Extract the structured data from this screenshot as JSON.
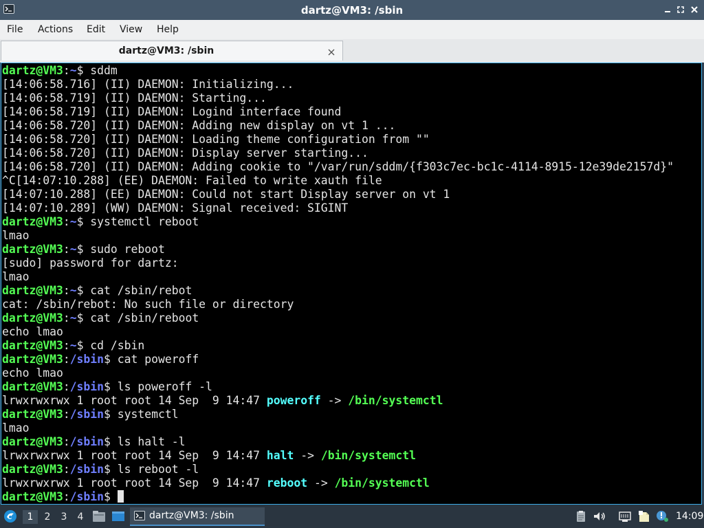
{
  "window": {
    "title": "dartz@VM3: /sbin"
  },
  "menu": {
    "items": [
      {
        "label": "File"
      },
      {
        "label": "Actions"
      },
      {
        "label": "Edit"
      },
      {
        "label": "View"
      },
      {
        "label": "Help"
      }
    ]
  },
  "tab": {
    "label": "dartz@VM3: /sbin"
  },
  "terminal": {
    "colors": {
      "background": "#000000",
      "text": "#e5e5e5",
      "prompt_user": "#54ff54",
      "prompt_path": "#6f7fff",
      "symlink": "#54ffff",
      "link_target": "#54ff54"
    },
    "lines": [
      [
        {
          "t": "dartz@VM3",
          "c": "prompt-user"
        },
        {
          "t": ":",
          "c": "plain"
        },
        {
          "t": "~",
          "c": "prompt-path"
        },
        {
          "t": "$ sddm",
          "c": "plain"
        }
      ],
      [
        {
          "t": "[14:06:58.716] (II) DAEMON: Initializing...",
          "c": "plain"
        }
      ],
      [
        {
          "t": "[14:06:58.719] (II) DAEMON: Starting...",
          "c": "plain"
        }
      ],
      [
        {
          "t": "[14:06:58.719] (II) DAEMON: Logind interface found",
          "c": "plain"
        }
      ],
      [
        {
          "t": "[14:06:58.720] (II) DAEMON: Adding new display on vt 1 ...",
          "c": "plain"
        }
      ],
      [
        {
          "t": "[14:06:58.720] (II) DAEMON: Loading theme configuration from \"\"",
          "c": "plain"
        }
      ],
      [
        {
          "t": "[14:06:58.720] (II) DAEMON: Display server starting...",
          "c": "plain"
        }
      ],
      [
        {
          "t": "[14:06:58.720] (II) DAEMON: Adding cookie to \"/var/run/sddm/{f303c7ec-bc1c-4114-8915-12e39de2157d}\"",
          "c": "plain"
        }
      ],
      [
        {
          "t": "^C[14:07:10.288] (EE) DAEMON: Failed to write xauth file",
          "c": "plain"
        }
      ],
      [
        {
          "t": "[14:07:10.288] (EE) DAEMON: Could not start Display server on vt 1",
          "c": "plain"
        }
      ],
      [
        {
          "t": "[14:07:10.289] (WW) DAEMON: Signal received: SIGINT",
          "c": "plain"
        }
      ],
      [
        {
          "t": "dartz@VM3",
          "c": "prompt-user"
        },
        {
          "t": ":",
          "c": "plain"
        },
        {
          "t": "~",
          "c": "prompt-path"
        },
        {
          "t": "$ systemctl reboot",
          "c": "plain"
        }
      ],
      [
        {
          "t": "lmao",
          "c": "plain"
        }
      ],
      [
        {
          "t": "dartz@VM3",
          "c": "prompt-user"
        },
        {
          "t": ":",
          "c": "plain"
        },
        {
          "t": "~",
          "c": "prompt-path"
        },
        {
          "t": "$ sudo reboot",
          "c": "plain"
        }
      ],
      [
        {
          "t": "[sudo] password for dartz:",
          "c": "plain"
        }
      ],
      [
        {
          "t": "lmao",
          "c": "plain"
        }
      ],
      [
        {
          "t": "dartz@VM3",
          "c": "prompt-user"
        },
        {
          "t": ":",
          "c": "plain"
        },
        {
          "t": "~",
          "c": "prompt-path"
        },
        {
          "t": "$ cat /sbin/rebot",
          "c": "plain"
        }
      ],
      [
        {
          "t": "cat: /sbin/rebot: No such file or directory",
          "c": "plain"
        }
      ],
      [
        {
          "t": "dartz@VM3",
          "c": "prompt-user"
        },
        {
          "t": ":",
          "c": "plain"
        },
        {
          "t": "~",
          "c": "prompt-path"
        },
        {
          "t": "$ cat /sbin/reboot",
          "c": "plain"
        }
      ],
      [
        {
          "t": "echo lmao",
          "c": "plain"
        }
      ],
      [
        {
          "t": "dartz@VM3",
          "c": "prompt-user"
        },
        {
          "t": ":",
          "c": "plain"
        },
        {
          "t": "~",
          "c": "prompt-path"
        },
        {
          "t": "$ cd /sbin",
          "c": "plain"
        }
      ],
      [
        {
          "t": "dartz@VM3",
          "c": "prompt-user"
        },
        {
          "t": ":",
          "c": "plain"
        },
        {
          "t": "/sbin",
          "c": "prompt-path"
        },
        {
          "t": "$ cat poweroff",
          "c": "plain"
        }
      ],
      [
        {
          "t": "echo lmao",
          "c": "plain"
        }
      ],
      [
        {
          "t": "dartz@VM3",
          "c": "prompt-user"
        },
        {
          "t": ":",
          "c": "plain"
        },
        {
          "t": "/sbin",
          "c": "prompt-path"
        },
        {
          "t": "$ ls poweroff -l",
          "c": "plain"
        }
      ],
      [
        {
          "t": "lrwxrwxrwx 1 root root 14 Sep  9 14:47 ",
          "c": "plain"
        },
        {
          "t": "poweroff",
          "c": "link"
        },
        {
          "t": " -> ",
          "c": "plain"
        },
        {
          "t": "/bin/systemctl",
          "c": "target"
        }
      ],
      [
        {
          "t": "dartz@VM3",
          "c": "prompt-user"
        },
        {
          "t": ":",
          "c": "plain"
        },
        {
          "t": "/sbin",
          "c": "prompt-path"
        },
        {
          "t": "$ systemctl",
          "c": "plain"
        }
      ],
      [
        {
          "t": "lmao",
          "c": "plain"
        }
      ],
      [
        {
          "t": "dartz@VM3",
          "c": "prompt-user"
        },
        {
          "t": ":",
          "c": "plain"
        },
        {
          "t": "/sbin",
          "c": "prompt-path"
        },
        {
          "t": "$ ls halt -l",
          "c": "plain"
        }
      ],
      [
        {
          "t": "lrwxrwxrwx 1 root root 14 Sep  9 14:47 ",
          "c": "plain"
        },
        {
          "t": "halt",
          "c": "link"
        },
        {
          "t": " -> ",
          "c": "plain"
        },
        {
          "t": "/bin/systemctl",
          "c": "target"
        }
      ],
      [
        {
          "t": "dartz@VM3",
          "c": "prompt-user"
        },
        {
          "t": ":",
          "c": "plain"
        },
        {
          "t": "/sbin",
          "c": "prompt-path"
        },
        {
          "t": "$ ls reboot -l",
          "c": "plain"
        }
      ],
      [
        {
          "t": "lrwxrwxrwx 1 root root 14 Sep  9 14:47 ",
          "c": "plain"
        },
        {
          "t": "reboot",
          "c": "link"
        },
        {
          "t": " -> ",
          "c": "plain"
        },
        {
          "t": "/bin/systemctl",
          "c": "target"
        }
      ],
      [
        {
          "t": "dartz@VM3",
          "c": "prompt-user"
        },
        {
          "t": ":",
          "c": "plain"
        },
        {
          "t": "/sbin",
          "c": "prompt-path"
        },
        {
          "t": "$ ",
          "c": "plain"
        },
        {
          "t": "",
          "c": "cursor"
        }
      ]
    ]
  },
  "taskbar": {
    "start_icon": "lxqt-start-icon",
    "workspaces": [
      {
        "label": "1",
        "active": true
      },
      {
        "label": "2",
        "active": false
      },
      {
        "label": "3",
        "active": false
      },
      {
        "label": "4",
        "active": false
      }
    ],
    "task_label": "dartz@VM3: /sbin",
    "tray_icons": [
      "clipboard-icon",
      "volume-icon",
      "network-icon",
      "notes-icon",
      "update-notifier-icon"
    ],
    "clock": "14:09"
  }
}
